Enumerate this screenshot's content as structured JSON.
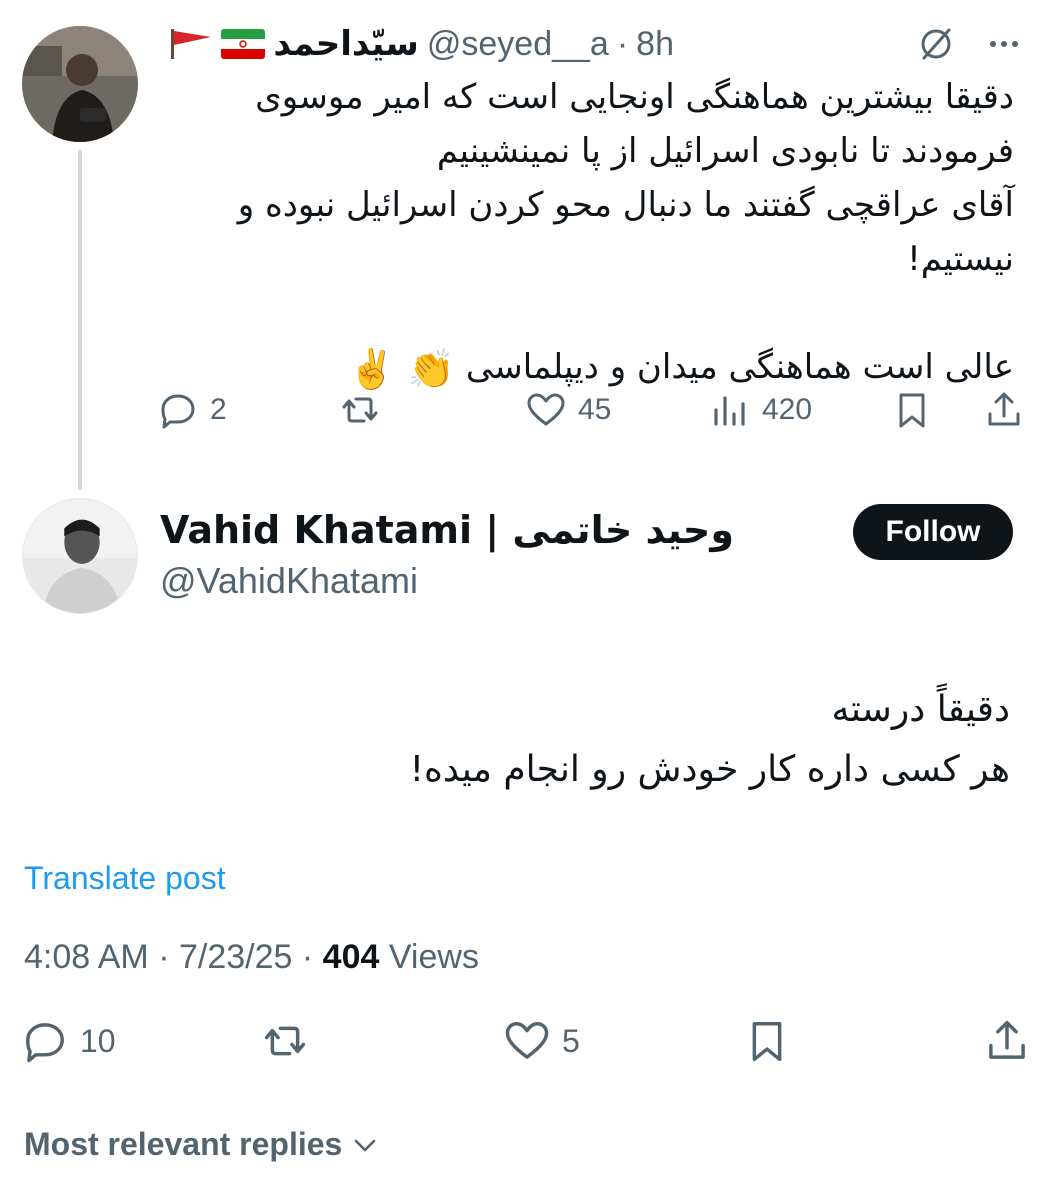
{
  "parent_tweet": {
    "display_name": "سیّداحمد",
    "handle": "@seyed__a",
    "time": "8h",
    "separator": "·",
    "body_lines": [
      "دقیقا بیشترین هماهنگی اونجایی است که امیر موسوی",
      "فرمودند تا نابودی اسرائیل از پا نمینشینیم",
      "آقای عراقچی گفتند ما دنبال محو کردن اسرائیل نبوده و",
      "نیستیم!"
    ],
    "closing_line": "عالی است هماهنگی میدان و دیپلماسی",
    "closing_emojis": "👏 ✌️",
    "actions": {
      "reply_count": "2",
      "like_count": "45",
      "views_count": "420"
    }
  },
  "main_tweet": {
    "display_name": "Vahid Khatami | وحید خاتمی",
    "handle": "@VahidKhatami",
    "follow_label": "Follow",
    "body_lines": [
      "دقیقاً درسته",
      "هر کسی داره کار خودش رو انجام میده!"
    ],
    "translate_label": "Translate post",
    "meta": {
      "time": "4:08 AM",
      "date": "7/23/25",
      "separator": "·",
      "views_number": "404",
      "views_label": "Views"
    },
    "actions": {
      "reply_count": "10",
      "like_count": "5"
    }
  },
  "replies_sort_label": "Most relevant replies",
  "colors": {
    "text_primary": "#0f1419",
    "text_secondary": "#536471",
    "link": "#1d9bf0",
    "thread_line": "#cfd9de",
    "follow_bg": "#0f1419"
  }
}
